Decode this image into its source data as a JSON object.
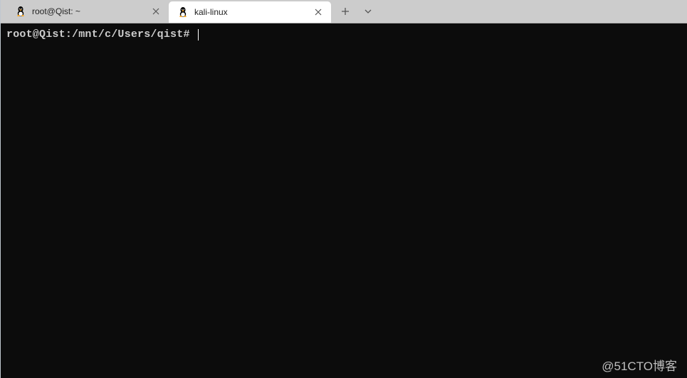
{
  "tabs": [
    {
      "title": "root@Qist: ~",
      "active": false
    },
    {
      "title": "kali-linux",
      "active": true
    }
  ],
  "terminal": {
    "prompt": "root@Qist:/mnt/c/Users/qist#"
  },
  "watermark": "@51CTO博客"
}
